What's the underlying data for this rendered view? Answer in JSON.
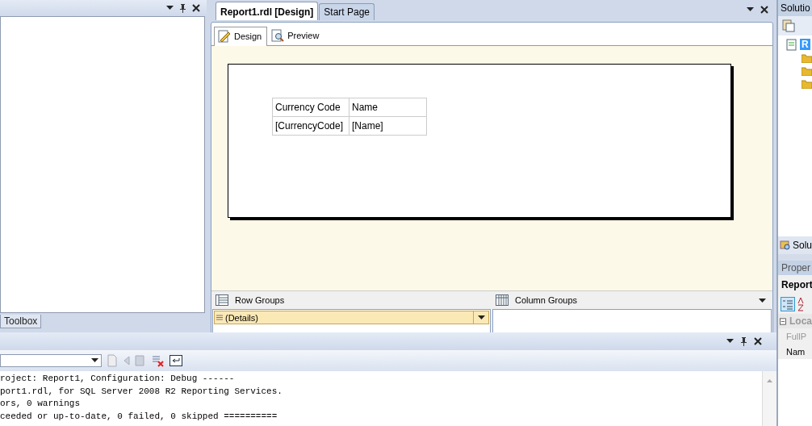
{
  "left_pane": {
    "tab": "Toolbox"
  },
  "document": {
    "tabs": [
      {
        "label": "Report1.rdl [Design]",
        "selected": true
      },
      {
        "label": "Start Page",
        "selected": false
      }
    ],
    "view_tabs": [
      {
        "label": "Design",
        "selected": true
      },
      {
        "label": "Preview",
        "selected": false
      }
    ],
    "table": {
      "header": [
        "Currency Code",
        "Name"
      ],
      "row": [
        "[CurrencyCode]",
        "[Name]"
      ]
    },
    "row_groups": {
      "title": "Row Groups",
      "items": [
        "(Details)"
      ]
    },
    "column_groups": {
      "title": "Column Groups"
    }
  },
  "output": {
    "lines": [
      "roject: Report1, Configuration: Debug ------",
      "port1.rdl, for SQL Server 2008 R2 Reporting Services.",
      "ors, 0 warnings",
      "ceeded or up-to-date, 0 failed, 0 skipped =========="
    ]
  },
  "solution_explorer": {
    "title": "Solutio",
    "items": [
      {
        "label": "R",
        "selected": true
      }
    ],
    "tab": "Solu"
  },
  "properties": {
    "title": "Proper",
    "object": "Report",
    "category": {
      "label": "Loca",
      "expanded": true
    },
    "rows": [
      {
        "label": "FullP",
        "disabled": true
      },
      {
        "label": "Nam",
        "disabled": false
      }
    ]
  }
}
